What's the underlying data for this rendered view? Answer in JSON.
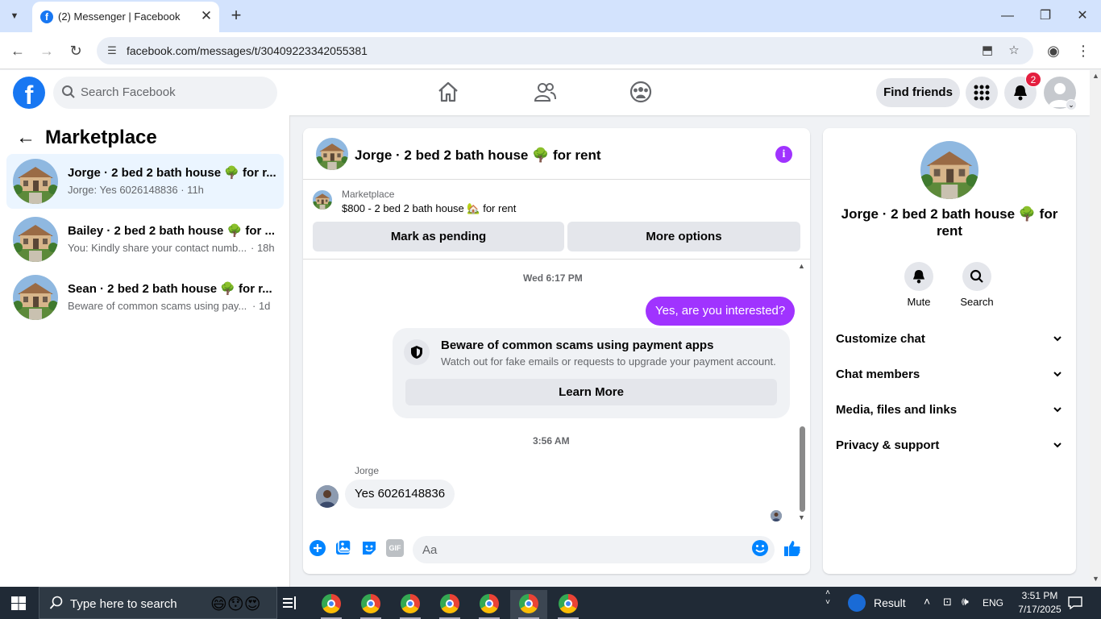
{
  "browser": {
    "tab_title": "(2) Messenger | Facebook",
    "tab_favicon": "f",
    "url": "facebook.com/messages/t/30409223342055381"
  },
  "header": {
    "search_placeholder": "Search Facebook",
    "find_friends": "Find friends",
    "notification_count": "2"
  },
  "sidebar": {
    "title": "Marketplace",
    "conversations": [
      {
        "name": "Jorge · 2 bed 2 bath house 🌳 for r...",
        "snippet": "Jorge: Yes 6026148836 · 11h",
        "time": "",
        "active": true
      },
      {
        "name": "Bailey · 2 bed 2 bath house 🌳 for ...",
        "snippet": "You: Kindly share your contact numb...",
        "time": "· 18h",
        "active": false
      },
      {
        "name": "Sean · 2 bed 2 bath house 🌳 for r...",
        "snippet": "Beware of common scams using pay...",
        "time": "· 1d",
        "active": false
      }
    ]
  },
  "chat": {
    "title": "Jorge · 2 bed 2 bath house 🌳 for rent",
    "marketplace_label": "Marketplace",
    "listing": "$800 - 2 bed 2 bath house 🏡 for rent",
    "mark_pending": "Mark as pending",
    "more_options": "More options",
    "timestamp_1": "Wed 6:17 PM",
    "outgoing_message": "Yes, are you interested?",
    "warning_title": "Beware of common scams using payment apps",
    "warning_subtitle": "Watch out for fake emails or requests to upgrade your payment account.",
    "learn_more": "Learn More",
    "timestamp_2": "3:56 AM",
    "sender_name": "Jorge",
    "incoming_message": "Yes 6026148836",
    "input_placeholder": "Aa"
  },
  "info_panel": {
    "name": "Jorge · 2 bed 2 bath house 🌳 for rent",
    "mute": "Mute",
    "search": "Search",
    "sections": [
      "Customize chat",
      "Chat members",
      "Media, files and links",
      "Privacy & support"
    ]
  },
  "taskbar": {
    "search_placeholder": "Type here to search",
    "weather": "Result",
    "lang": "ENG",
    "time": "3:51 PM",
    "date": "7/17/2025"
  },
  "colors": {
    "accent": "#a033ff",
    "fb_blue": "#1877f2",
    "badge_red": "#e41e3f"
  }
}
